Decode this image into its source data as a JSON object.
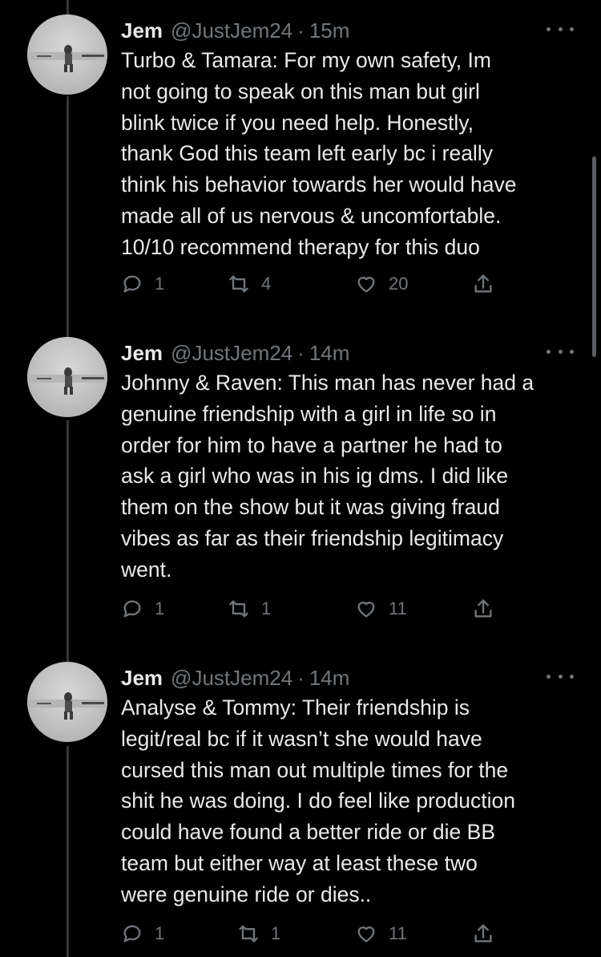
{
  "tweets": [
    {
      "name": "Jem",
      "handle": "@JustJem24",
      "separator": "·",
      "time": "15m",
      "text": "Turbo & Tamara: For my own safety, Im\nnot going to speak on this man but girl\nblink twice if you need help. Honestly,\nthank God this team left early bc i really\nthink his behavior towards her would have\nmade all of us nervous & uncomfortable.\n10/10 recommend therapy for this duo",
      "replies": "1",
      "retweets": "4",
      "likes": "20"
    },
    {
      "name": "Jem",
      "handle": "@JustJem24",
      "separator": "·",
      "time": "14m",
      "text": "Johnny & Raven: This man has never had a\ngenuine friendship with a girl in life so in\norder for him to have a partner he had to\nask a girl who was in his ig dms. I did like\nthem on the show but it was giving fraud\nvibes as far as their friendship legitimacy\nwent.",
      "replies": "1",
      "retweets": "1",
      "likes": "11"
    },
    {
      "name": "Jem",
      "handle": "@JustJem24",
      "separator": "·",
      "time": "14m",
      "text": "Analyse & Tommy: Their friendship is\nlegit/real bc if it wasn’t she would have\ncursed this man out multiple times for the\nshit he was doing. I do feel like production\ncould have found a better ride or die BB\nteam but either way at least these two\nwere genuine ride or dies..",
      "replies": "1",
      "retweets": "1",
      "likes": "11"
    }
  ],
  "icons": {
    "reply": "reply-icon",
    "retweet": "retweet-icon",
    "like": "heart-icon",
    "share": "share-icon",
    "more": "more-icon"
  },
  "colors": {
    "background": "#000000",
    "text": "#e7e9ea",
    "secondary": "#71767b",
    "thread_line": "#333639"
  }
}
